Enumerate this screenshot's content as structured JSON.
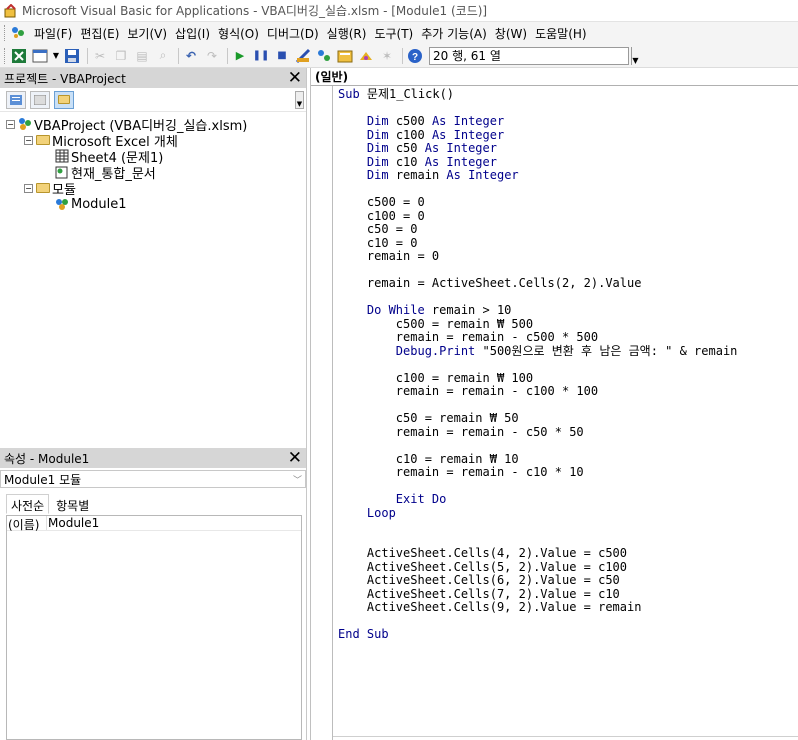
{
  "window": {
    "title": "Microsoft Visual Basic for Applications - VBA디버깅_실습.xlsm - [Module1 (코드)]"
  },
  "menu": {
    "items": [
      "파일(F)",
      "편집(E)",
      "보기(V)",
      "삽입(I)",
      "형식(O)",
      "디버그(D)",
      "실행(R)",
      "도구(T)",
      "추가 기능(A)",
      "창(W)",
      "도움말(H)"
    ]
  },
  "toolbar": {
    "position_text": "20 행, 61 열"
  },
  "project_panel": {
    "title": "프로젝트 - VBAProject",
    "tree": [
      {
        "label": "VBAProject (VBA디버깅_실습.xlsm)",
        "level": 0,
        "icon": "vba-project-icon"
      },
      {
        "label": "Microsoft Excel 개체",
        "level": 1,
        "icon": "folder-icon"
      },
      {
        "label": "Sheet4 (문제1)",
        "level": 2,
        "icon": "sheet-icon"
      },
      {
        "label": "현재_통합_문서",
        "level": 2,
        "icon": "workbook-icon"
      },
      {
        "label": "모듈",
        "level": 1,
        "icon": "folder-icon"
      },
      {
        "label": "Module1",
        "level": 2,
        "icon": "module-icon"
      }
    ]
  },
  "properties_panel": {
    "title": "속성 - Module1",
    "object_name": "Module1",
    "object_type": "모듈",
    "tabs": [
      "사전순",
      "항목별"
    ],
    "rows": [
      {
        "name": "(이름)",
        "value": "Module1"
      }
    ]
  },
  "editor": {
    "object_dropdown": "(일반)",
    "code_lines": [
      {
        "indent": 0,
        "parts": [
          [
            "kw",
            "Sub"
          ],
          [
            "",
            " 문제1_Click()"
          ]
        ]
      },
      {
        "indent": 0,
        "parts": []
      },
      {
        "indent": 4,
        "parts": [
          [
            "kw",
            "Dim"
          ],
          [
            "",
            " c500 "
          ],
          [
            "kw",
            "As Integer"
          ]
        ]
      },
      {
        "indent": 4,
        "parts": [
          [
            "kw",
            "Dim"
          ],
          [
            "",
            " c100 "
          ],
          [
            "kw",
            "As Integer"
          ]
        ]
      },
      {
        "indent": 4,
        "parts": [
          [
            "kw",
            "Dim"
          ],
          [
            "",
            " c50 "
          ],
          [
            "kw",
            "As Integer"
          ]
        ]
      },
      {
        "indent": 4,
        "parts": [
          [
            "kw",
            "Dim"
          ],
          [
            "",
            " c10 "
          ],
          [
            "kw",
            "As Integer"
          ]
        ]
      },
      {
        "indent": 4,
        "parts": [
          [
            "kw",
            "Dim"
          ],
          [
            "",
            " remain "
          ],
          [
            "kw",
            "As Integer"
          ]
        ]
      },
      {
        "indent": 0,
        "parts": []
      },
      {
        "indent": 4,
        "parts": [
          [
            "",
            "c500 = 0"
          ]
        ]
      },
      {
        "indent": 4,
        "parts": [
          [
            "",
            "c100 = 0"
          ]
        ]
      },
      {
        "indent": 4,
        "parts": [
          [
            "",
            "c50 = 0"
          ]
        ]
      },
      {
        "indent": 4,
        "parts": [
          [
            "",
            "c10 = 0"
          ]
        ]
      },
      {
        "indent": 4,
        "parts": [
          [
            "",
            "remain = 0"
          ]
        ]
      },
      {
        "indent": 0,
        "parts": []
      },
      {
        "indent": 4,
        "parts": [
          [
            "",
            "remain = ActiveSheet.Cells(2, 2).Value"
          ]
        ]
      },
      {
        "indent": 0,
        "parts": []
      },
      {
        "indent": 4,
        "parts": [
          [
            "kw",
            "Do While"
          ],
          [
            "",
            " remain > 10"
          ]
        ]
      },
      {
        "indent": 8,
        "parts": [
          [
            "",
            "c500 = remain ₩ 500"
          ]
        ]
      },
      {
        "indent": 8,
        "parts": [
          [
            "",
            "remain = remain - c500 * 500"
          ]
        ]
      },
      {
        "indent": 8,
        "parts": [
          [
            "kw",
            "Debug.Print"
          ],
          [
            "",
            " \"500원으로 변환 후 남은 금액: \" & remain"
          ]
        ]
      },
      {
        "indent": 0,
        "parts": []
      },
      {
        "indent": 8,
        "parts": [
          [
            "",
            "c100 = remain ₩ 100"
          ]
        ]
      },
      {
        "indent": 8,
        "parts": [
          [
            "",
            "remain = remain - c100 * 100"
          ]
        ]
      },
      {
        "indent": 0,
        "parts": []
      },
      {
        "indent": 8,
        "parts": [
          [
            "",
            "c50 = remain ₩ 50"
          ]
        ]
      },
      {
        "indent": 8,
        "parts": [
          [
            "",
            "remain = remain - c50 * 50"
          ]
        ]
      },
      {
        "indent": 0,
        "parts": []
      },
      {
        "indent": 8,
        "parts": [
          [
            "",
            "c10 = remain ₩ 10"
          ]
        ]
      },
      {
        "indent": 8,
        "parts": [
          [
            "",
            "remain = remain - c10 * 10"
          ]
        ]
      },
      {
        "indent": 0,
        "parts": []
      },
      {
        "indent": 8,
        "parts": [
          [
            "kw",
            "Exit Do"
          ]
        ]
      },
      {
        "indent": 4,
        "parts": [
          [
            "kw",
            "Loop"
          ]
        ]
      },
      {
        "indent": 0,
        "parts": []
      },
      {
        "indent": 0,
        "parts": []
      },
      {
        "indent": 4,
        "parts": [
          [
            "",
            "ActiveSheet.Cells(4, 2).Value = c500"
          ]
        ]
      },
      {
        "indent": 4,
        "parts": [
          [
            "",
            "ActiveSheet.Cells(5, 2).Value = c100"
          ]
        ]
      },
      {
        "indent": 4,
        "parts": [
          [
            "",
            "ActiveSheet.Cells(6, 2).Value = c50"
          ]
        ]
      },
      {
        "indent": 4,
        "parts": [
          [
            "",
            "ActiveSheet.Cells(7, 2).Value = c10"
          ]
        ]
      },
      {
        "indent": 4,
        "parts": [
          [
            "",
            "ActiveSheet.Cells(9, 2).Value = remain"
          ]
        ]
      },
      {
        "indent": 0,
        "parts": []
      },
      {
        "indent": 0,
        "parts": [
          [
            "kw",
            "End Sub"
          ]
        ]
      }
    ]
  },
  "colors": {
    "keyword": "#00008b",
    "panel_header": "#d6d6d6"
  }
}
